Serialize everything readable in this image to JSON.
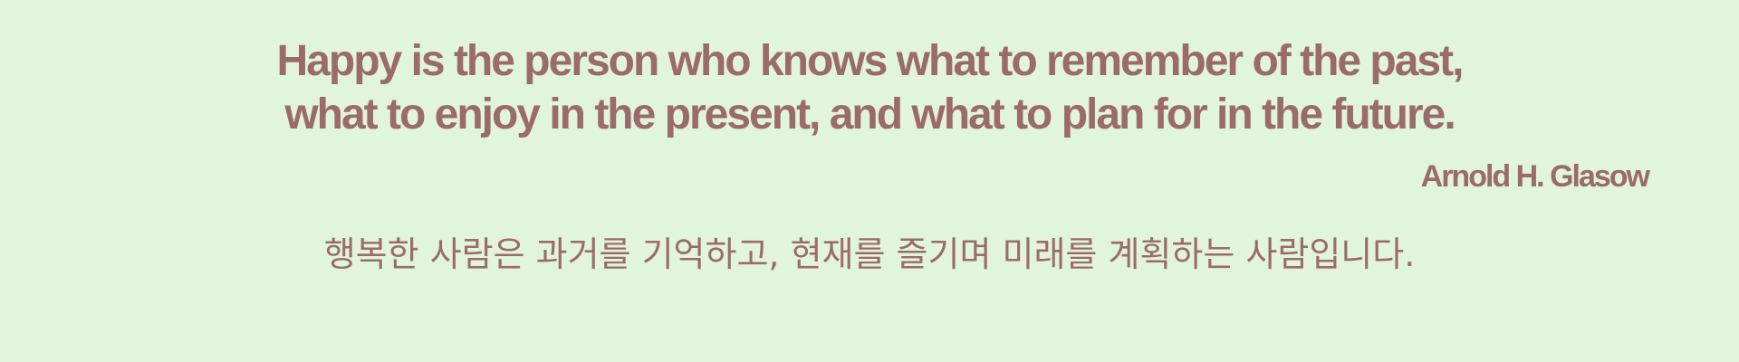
{
  "quote": {
    "line_1": "Happy is the person who knows what to remember of the past,",
    "line_2": "what to enjoy in the present, and what to plan for in the future.",
    "author": "Arnold H. Glasow",
    "translation": "행복한 사람은 과거를 기억하고, 현재를 즐기며 미래를 계획하는 사람입니다."
  },
  "colors": {
    "background": "#e1f5dc",
    "text": "#9b6b6b"
  }
}
